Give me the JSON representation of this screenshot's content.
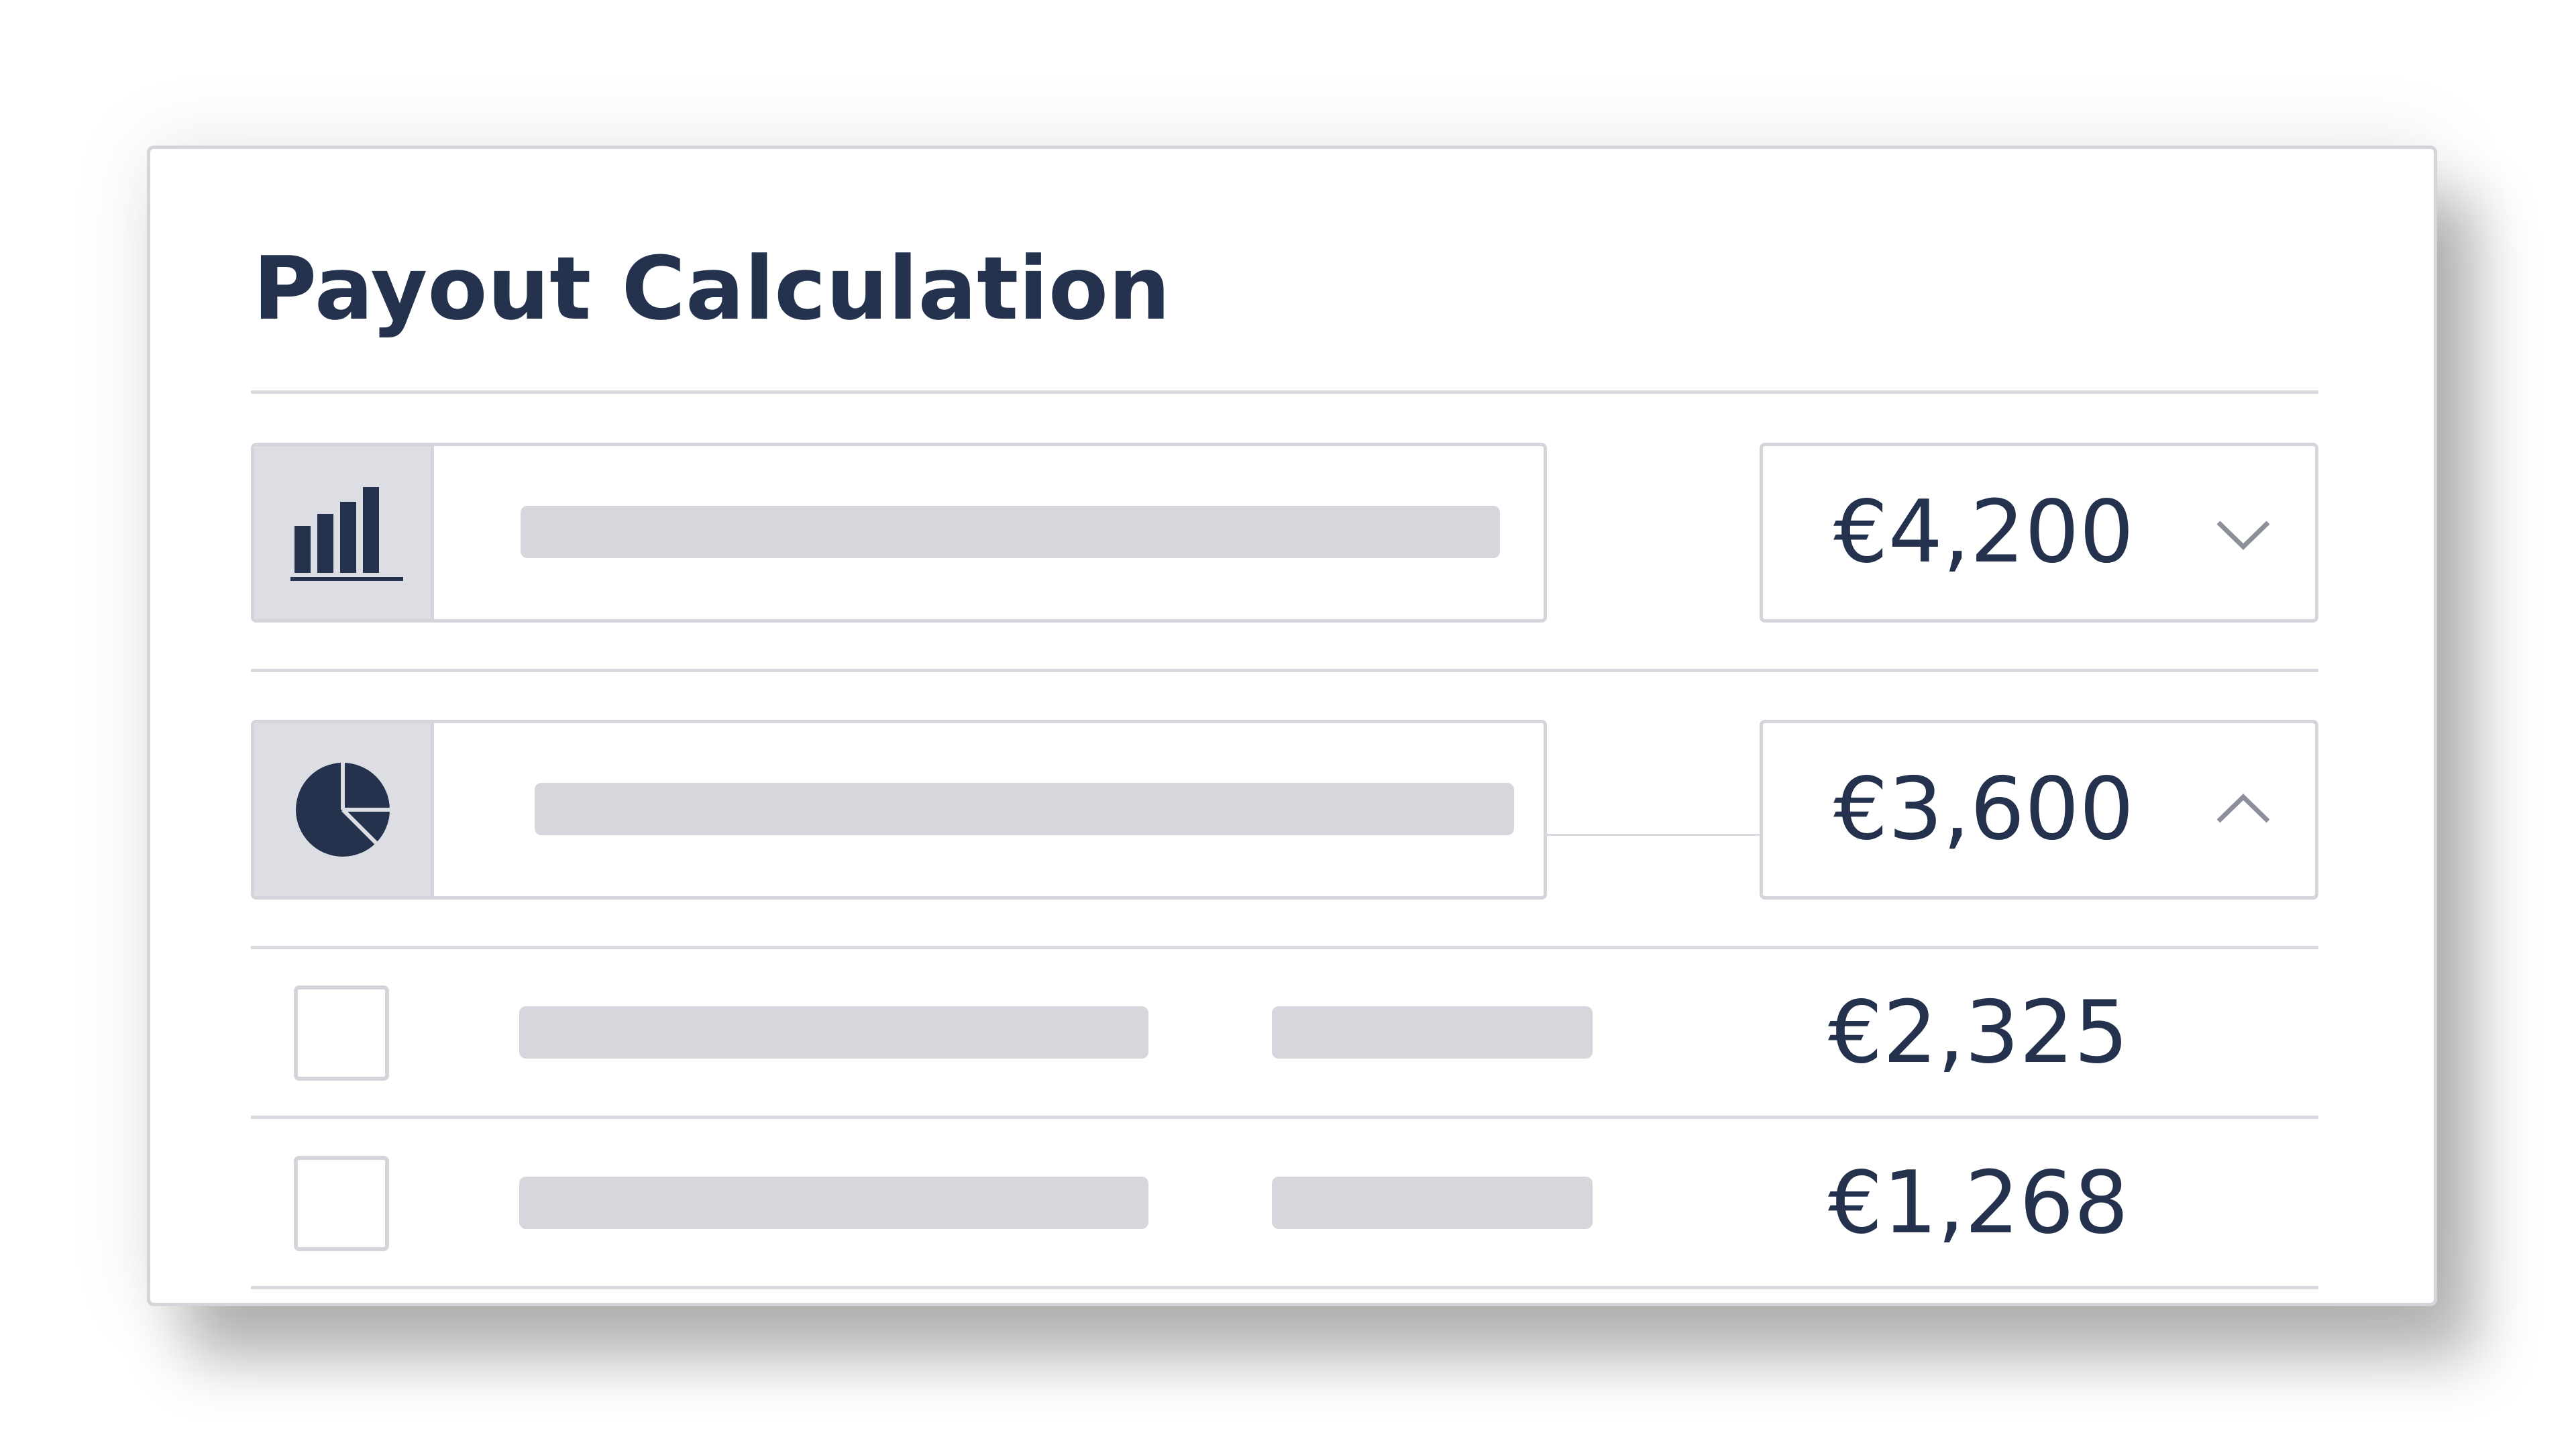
{
  "card": {
    "title": "Payout Calculation"
  },
  "fields": [
    {
      "icon": "bar-chart-icon",
      "amount": "€4,200",
      "dropdown_state": "collapsed",
      "chevron": "chevron-down-icon"
    },
    {
      "icon": "pie-chart-icon",
      "amount": "€3,600",
      "dropdown_state": "expanded",
      "chevron": "chevron-up-icon"
    }
  ],
  "rows": [
    {
      "amount": "€2,325",
      "checked": false
    },
    {
      "amount": "€1,268",
      "checked": false
    }
  ],
  "colors": {
    "text": "#24324d",
    "border": "#d3d5db",
    "placeholder": "#d5d7dd",
    "icon_bg": "#dcdee3"
  }
}
